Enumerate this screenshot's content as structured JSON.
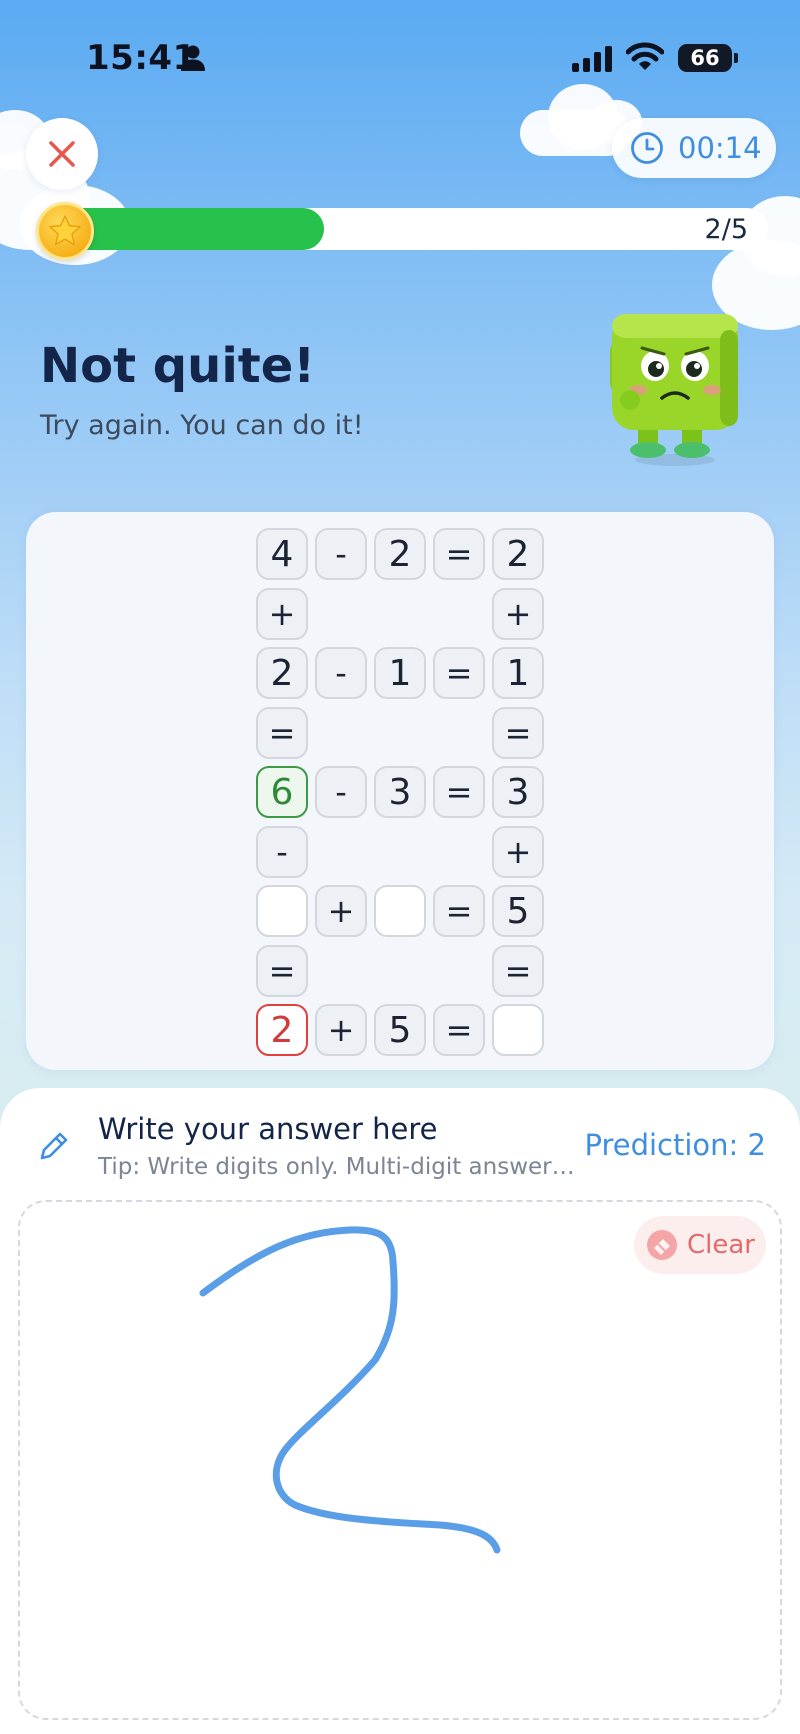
{
  "status_bar": {
    "time": "15:41",
    "battery": "66"
  },
  "header": {
    "timer": "00:14",
    "progress_label": "2/5",
    "progress_fraction": 0.38
  },
  "feedback": {
    "title": "Not quite!",
    "subtitle": "Try again. You can do it!"
  },
  "puzzle": {
    "rows": [
      [
        "4",
        "-",
        "2",
        "=",
        "2"
      ],
      [
        "+",
        "",
        "",
        "",
        "+"
      ],
      [
        "2",
        "-",
        "1",
        "=",
        "1"
      ],
      [
        "=",
        "",
        "",
        "",
        "="
      ],
      [
        "6",
        "-",
        "3",
        "=",
        "3"
      ],
      [
        "-",
        "",
        "",
        "",
        "+"
      ],
      [
        "",
        "+",
        "",
        "=",
        "5"
      ],
      [
        "=",
        "",
        "",
        "",
        "="
      ],
      [
        "2",
        "+",
        "5",
        "=",
        ""
      ]
    ],
    "correct_cell": "6",
    "wrong_cell": "2"
  },
  "answer_panel": {
    "title": "Write your answer here",
    "tip": "Tip: Write digits only. Multi-digit answer…",
    "prediction": "Prediction: 2",
    "clear_label": "Clear"
  },
  "colors": {
    "accent_blue": "#3f8ee0",
    "progress_green": "#27c24c",
    "correct_green": "#3c9a46",
    "wrong_red": "#e04040",
    "stroke_blue": "#5b9ee8"
  },
  "icons": {
    "close": "close-icon",
    "timer": "clock-icon",
    "coin": "star-coin-icon",
    "pencil": "pencil-icon",
    "eraser": "eraser-icon"
  }
}
